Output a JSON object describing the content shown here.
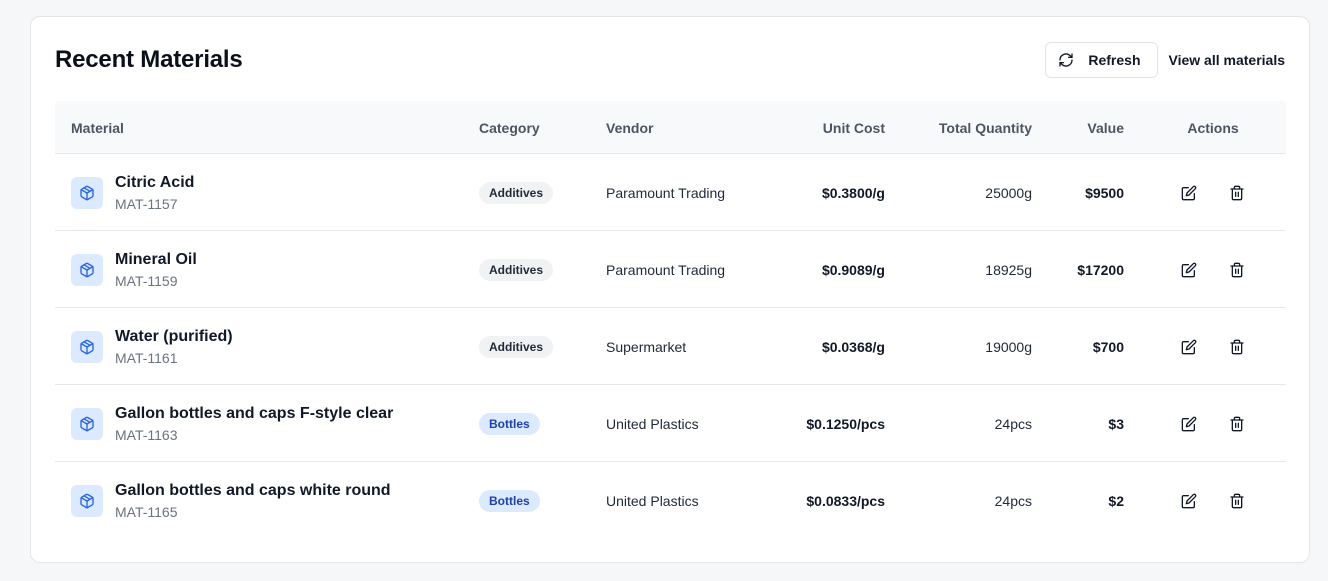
{
  "header": {
    "title": "Recent Materials",
    "refresh_label": "Refresh",
    "view_all_label": "View all materials"
  },
  "table": {
    "columns": [
      "Material",
      "Category",
      "Vendor",
      "Unit Cost",
      "Total Quantity",
      "Value",
      "Actions"
    ],
    "rows": [
      {
        "name": "Citric Acid",
        "code": "MAT-1157",
        "category": "Additives",
        "vendor": "Paramount Trading",
        "unit_cost": "$0.3800/g",
        "quantity": "25000g",
        "value": "$9500"
      },
      {
        "name": "Mineral Oil",
        "code": "MAT-1159",
        "category": "Additives",
        "vendor": "Paramount Trading",
        "unit_cost": "$0.9089/g",
        "quantity": "18925g",
        "value": "$17200"
      },
      {
        "name": "Water (purified)",
        "code": "MAT-1161",
        "category": "Additives",
        "vendor": "Supermarket",
        "unit_cost": "$0.0368/g",
        "quantity": "19000g",
        "value": "$700"
      },
      {
        "name": "Gallon bottles and caps F-style clear",
        "code": "MAT-1163",
        "category": "Bottles",
        "vendor": "United Plastics",
        "unit_cost": "$0.1250/pcs",
        "quantity": "24pcs",
        "value": "$3"
      },
      {
        "name": "Gallon bottles and caps white round",
        "code": "MAT-1165",
        "category": "Bottles",
        "vendor": "United Plastics",
        "unit_cost": "$0.0833/pcs",
        "quantity": "24pcs",
        "value": "$2"
      }
    ]
  },
  "icons": {
    "refresh": "refresh-icon",
    "material": "package-icon",
    "edit": "edit-icon",
    "delete": "trash-icon"
  },
  "colors": {
    "accent": "#2563eb",
    "icon_bg": "#dbeafe",
    "bottles_badge_bg": "#dbeafe",
    "bottles_badge_text": "#1e40af",
    "additives_badge_bg": "#f1f2f4"
  }
}
